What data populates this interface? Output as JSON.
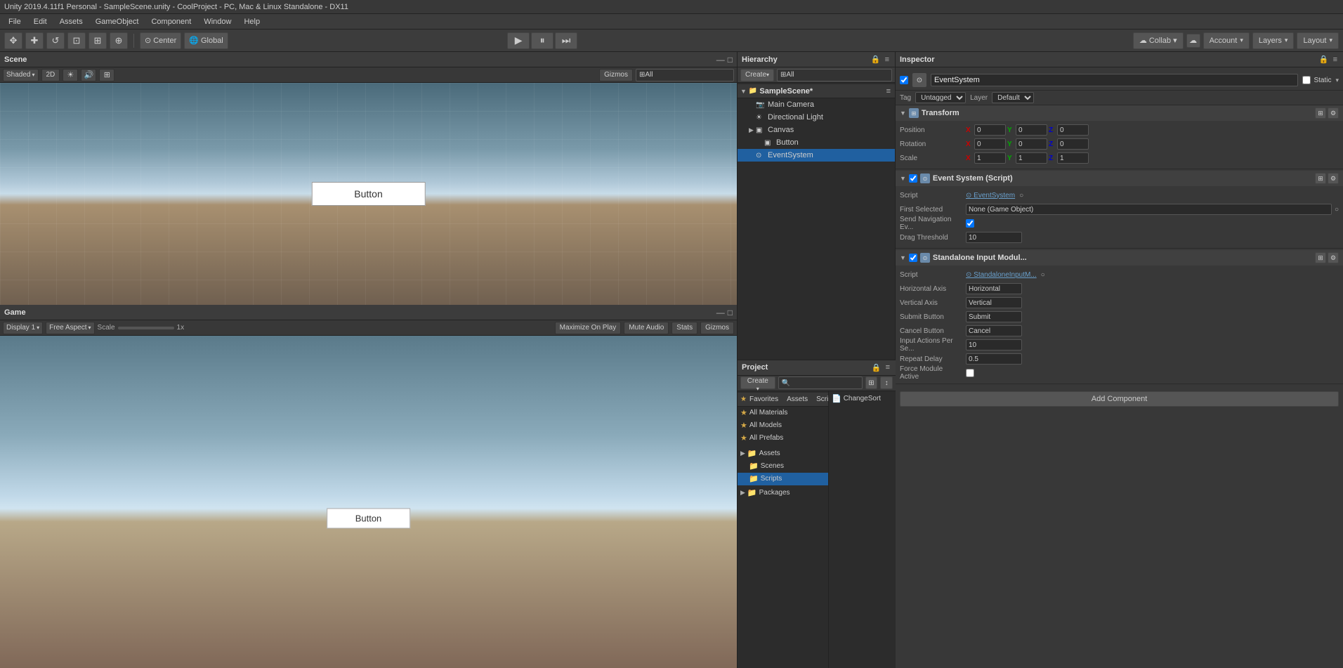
{
  "titlebar": {
    "text": "Unity 2019.4.11f1 Personal - SampleScene.unity - CoolProject - PC, Mac & Linux Standalone - DX11"
  },
  "menubar": {
    "items": [
      "File",
      "Edit",
      "Assets",
      "GameObject",
      "Component",
      "Window",
      "Help"
    ]
  },
  "toolbar": {
    "transform_tools": [
      "⊕",
      "✥",
      "↺",
      "⊡",
      "⊞",
      "⊙"
    ],
    "pivot_center": "Center",
    "pivot_global": "Global",
    "play_label": "▶",
    "pause_label": "⏸",
    "step_label": "⏭",
    "collab_label": "Collab ▾",
    "account_label": "Account",
    "layers_label": "Layers",
    "layout_label": "Layout"
  },
  "scene_panel": {
    "title": "Scene",
    "shading_mode": "Shaded",
    "toggle_2d": "2D",
    "gizmos_btn": "Gizmos",
    "search_placeholder": "⊞All",
    "button_label": "Button"
  },
  "game_panel": {
    "title": "Game",
    "display": "Display 1",
    "aspect": "Free Aspect",
    "scale_label": "Scale",
    "scale_value": "1x",
    "maximize_label": "Maximize On Play",
    "mute_label": "Mute Audio",
    "stats_label": "Stats",
    "gizmos_label": "Gizmos",
    "button_label": "Button"
  },
  "hierarchy": {
    "title": "Hierarchy",
    "create_label": "Create",
    "search_placeholder": "⊞All",
    "scene_name": "SampleScene*",
    "items": [
      {
        "id": "main-camera",
        "label": "Main Camera",
        "icon": "📷",
        "indent": 1,
        "arrow": ""
      },
      {
        "id": "directional-light",
        "label": "Directional Light",
        "icon": "☀",
        "indent": 1,
        "arrow": ""
      },
      {
        "id": "canvas",
        "label": "Canvas",
        "icon": "▣",
        "indent": 1,
        "arrow": "▶"
      },
      {
        "id": "button",
        "label": "Button",
        "icon": "▣",
        "indent": 2,
        "arrow": ""
      },
      {
        "id": "eventsystem",
        "label": "EventSystem",
        "icon": "⊙",
        "indent": 1,
        "arrow": "",
        "selected": true
      }
    ]
  },
  "inspector": {
    "title": "Inspector",
    "object_name": "EventSystem",
    "static_label": "Static",
    "tag_label": "Tag",
    "tag_value": "Untagged",
    "layer_label": "Layer",
    "layer_value": "Default",
    "components": [
      {
        "id": "transform",
        "title": "Transform",
        "enabled": true,
        "icon": "⊞",
        "fields": {
          "position": {
            "label": "Position",
            "x": "0",
            "y": "0",
            "z": "0"
          },
          "rotation": {
            "label": "Rotation",
            "x": "0",
            "y": "0",
            "z": "0"
          },
          "scale": {
            "label": "Scale",
            "x": "1",
            "y": "1",
            "z": "1"
          }
        }
      },
      {
        "id": "event-system-script",
        "title": "Event System (Script)",
        "enabled": true,
        "icon": "⊙",
        "fields": {
          "script": {
            "label": "Script",
            "value": "EventSystem"
          },
          "first_selected": {
            "label": "First Selected",
            "value": "None (Game Object)"
          },
          "send_navigation": {
            "label": "Send Navigation Events",
            "value": true
          },
          "drag_threshold": {
            "label": "Drag Threshold",
            "value": "10"
          }
        }
      },
      {
        "id": "standalone-input-module",
        "title": "Standalone Input Modul...",
        "enabled": true,
        "icon": "⊙",
        "fields": {
          "script": {
            "label": "Script",
            "value": "StandaloneInputM..."
          },
          "horizontal_axis": {
            "label": "Horizontal Axis",
            "value": "Horizontal"
          },
          "vertical_axis": {
            "label": "Vertical Axis",
            "value": "Vertical"
          },
          "submit_button": {
            "label": "Submit Button",
            "value": "Submit"
          },
          "cancel_button": {
            "label": "Cancel Button",
            "value": "Cancel"
          },
          "input_actions_per_second": {
            "label": "Input Actions Per Se...",
            "value": "10"
          },
          "repeat_delay": {
            "label": "Repeat Delay",
            "value": "0.5"
          },
          "force_module_active": {
            "label": "Force Module Active",
            "value": false
          }
        }
      }
    ],
    "add_component_label": "Add Component"
  },
  "project": {
    "title": "Project",
    "create_label": "Create",
    "search_placeholder": "🔍",
    "tabs": [
      {
        "id": "favorites",
        "label": "Favorites"
      },
      {
        "id": "assets",
        "label": "Assets"
      },
      {
        "id": "scripts",
        "label": "Scripts"
      }
    ],
    "favorites_items": [
      {
        "label": "All Materials",
        "icon": "★"
      },
      {
        "label": "All Models",
        "icon": "★"
      },
      {
        "label": "All Prefabs",
        "icon": "★"
      }
    ],
    "assets_items": [
      {
        "label": "Assets",
        "icon": "📁",
        "indent": 0,
        "arrow": "▶"
      },
      {
        "label": "Scenes",
        "icon": "📁",
        "indent": 1
      },
      {
        "label": "Scripts",
        "icon": "📁",
        "indent": 1,
        "selected": true
      },
      {
        "label": "Packages",
        "icon": "📁",
        "indent": 0,
        "arrow": "▶"
      }
    ],
    "right_items": [
      {
        "label": "ChangeSort",
        "icon": "📄"
      }
    ]
  },
  "colors": {
    "selected_bg": "#1a4a6a",
    "active_selected_bg": "#2060a0",
    "header_bg": "#3c3c3c",
    "panel_bg": "#383838",
    "dark_bg": "#2c2c2c",
    "border": "#222222",
    "accent_blue": "#2060a0"
  }
}
